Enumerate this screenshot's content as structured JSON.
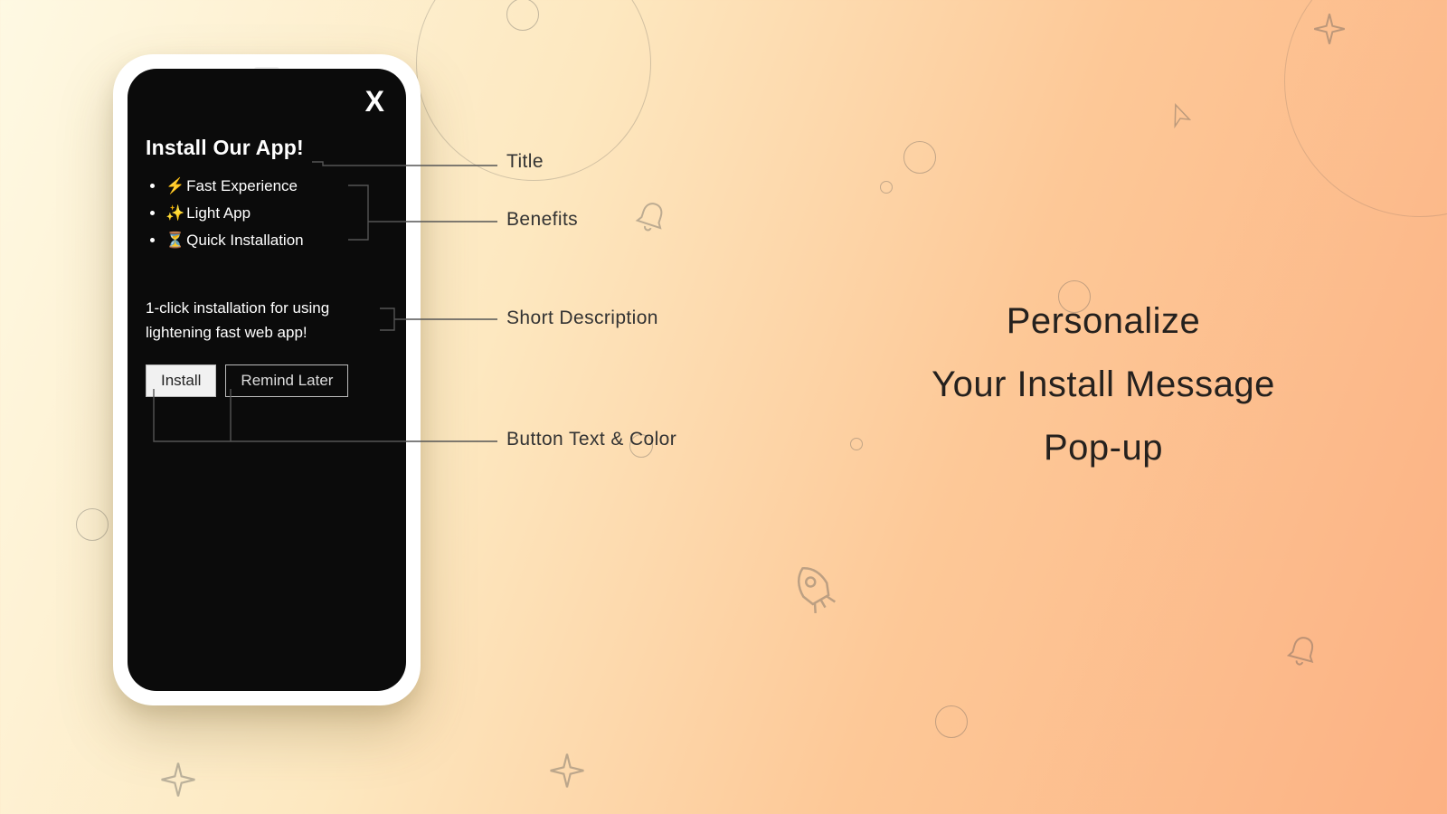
{
  "popup": {
    "close_glyph": "X",
    "title": "Install Our App!",
    "benefits": [
      {
        "emoji": "⚡",
        "text": "Fast Experience"
      },
      {
        "emoji": "✨",
        "text": "Light App"
      },
      {
        "emoji": "⏳",
        "text": "Quick Installation"
      }
    ],
    "description": "1-click installation for using lightening fast web app!",
    "install_label": "Install",
    "remind_label": "Remind Later"
  },
  "annotations": {
    "title": "Title",
    "benefits": "Benefits",
    "description": "Short Description",
    "button": "Button Text & Color"
  },
  "headline": {
    "l1": "Personalize",
    "l2": "Your Install Message",
    "l3": "Pop-up"
  },
  "colors": {
    "popup_bg": "#0b0b0b",
    "install_btn_bg": "#f1f1f1",
    "install_btn_fg": "#222222"
  }
}
